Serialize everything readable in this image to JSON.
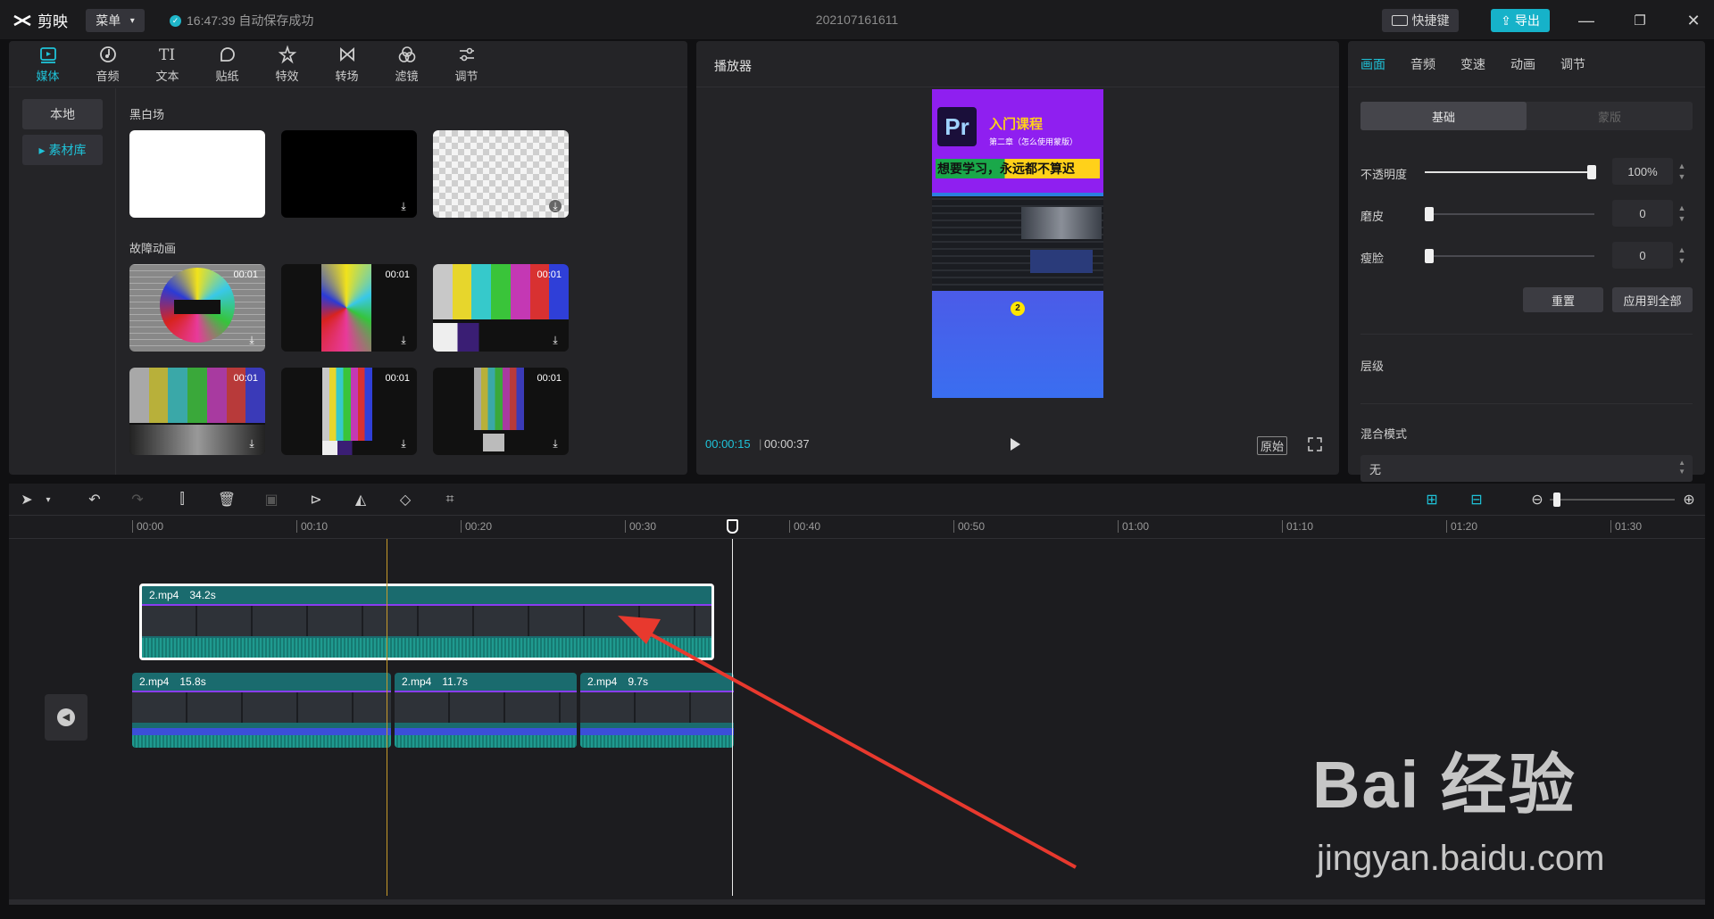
{
  "titlebar": {
    "app_name": "剪映",
    "menu_label": "菜单",
    "save_status": "16:47:39 自动保存成功",
    "project_name": "202107161611",
    "shortcut_label": "快捷键",
    "export_label": "导出"
  },
  "media": {
    "tabs": [
      {
        "label": "媒体",
        "icon": "media-icon",
        "active": true
      },
      {
        "label": "音频",
        "icon": "audio-icon"
      },
      {
        "label": "文本",
        "icon": "text-icon"
      },
      {
        "label": "贴纸",
        "icon": "sticker-icon"
      },
      {
        "label": "特效",
        "icon": "effects-icon"
      },
      {
        "label": "转场",
        "icon": "transition-icon"
      },
      {
        "label": "滤镜",
        "icon": "filter-icon"
      },
      {
        "label": "调节",
        "icon": "adjust-icon"
      }
    ],
    "side_nav": [
      {
        "label": "本地"
      },
      {
        "label": "▸ 素材库",
        "active": true
      }
    ],
    "section_bw": "黑白场",
    "section_glitch": "故障动画",
    "durations": [
      "00:01",
      "00:01",
      "00:01",
      "00:01",
      "00:01",
      "00:01"
    ]
  },
  "player": {
    "title": "播放器",
    "preview_title": "入门课程",
    "preview_subtitle": "第二章（怎么使用蒙版）",
    "preview_banner": "想要学习，永远都不算迟",
    "preview_logo": "Pr",
    "preview_badge": "2",
    "current_time": "00:00:15",
    "total_time": "00:00:37",
    "original_label": "原始"
  },
  "properties": {
    "tabs": [
      {
        "label": "画面",
        "active": true
      },
      {
        "label": "音频"
      },
      {
        "label": "变速"
      },
      {
        "label": "动画"
      },
      {
        "label": "调节"
      }
    ],
    "seg_basic": "基础",
    "seg_mask": "蒙版",
    "opacity_label": "不透明度",
    "opacity_value": "100%",
    "opacity_level": 1.0,
    "smooth_label": "磨皮",
    "smooth_value": "0",
    "slim_label": "瘦脸",
    "slim_value": "0",
    "reset_label": "重置",
    "apply_all_label": "应用到全部",
    "layer_label": "层级",
    "blend_label": "混合模式",
    "blend_value": "无"
  },
  "timeline": {
    "ruler_labels": [
      "00:00",
      "00:10",
      "00:20",
      "00:30",
      "00:40",
      "00:50",
      "01:00",
      "01:10",
      "01:20",
      "01:30"
    ],
    "clips_top": [
      {
        "name": "2.mp4",
        "duration": "34.2s"
      }
    ],
    "clips_main": [
      {
        "name": "2.mp4",
        "duration": "15.8s"
      },
      {
        "name": "2.mp4",
        "duration": "11.7s"
      },
      {
        "name": "2.mp4",
        "duration": "9.7s"
      }
    ]
  },
  "watermark": {
    "main": "Bai 经验",
    "sub": "jingyan.baidu.com"
  },
  "colors": {
    "accent": "#1fc3d9",
    "export": "#16b2c9",
    "clip": "#1a6b6e",
    "arrow": "#e8392e"
  }
}
